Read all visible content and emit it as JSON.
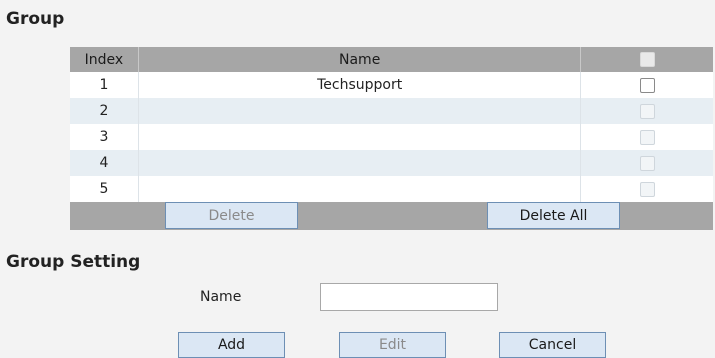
{
  "group": {
    "title": "Group",
    "columns": {
      "index": "Index",
      "name": "Name"
    },
    "rows": [
      {
        "index": "1",
        "name": "Techsupport",
        "checkbox_enabled": true
      },
      {
        "index": "2",
        "name": "",
        "checkbox_enabled": false
      },
      {
        "index": "3",
        "name": "",
        "checkbox_enabled": false
      },
      {
        "index": "4",
        "name": "",
        "checkbox_enabled": false
      },
      {
        "index": "5",
        "name": "",
        "checkbox_enabled": false
      }
    ],
    "delete_label": "Delete",
    "delete_all_label": "Delete All"
  },
  "group_setting": {
    "title": "Group Setting",
    "name_label": "Name",
    "name_value": "",
    "add_label": "Add",
    "edit_label": "Edit",
    "cancel_label": "Cancel"
  },
  "colors": {
    "background": "#f3f3f3",
    "header_bar": "#a6a6a6",
    "row_alt": "#e7eef3",
    "button_fill": "#dbe7f4",
    "button_border": "#6d8fb4"
  }
}
